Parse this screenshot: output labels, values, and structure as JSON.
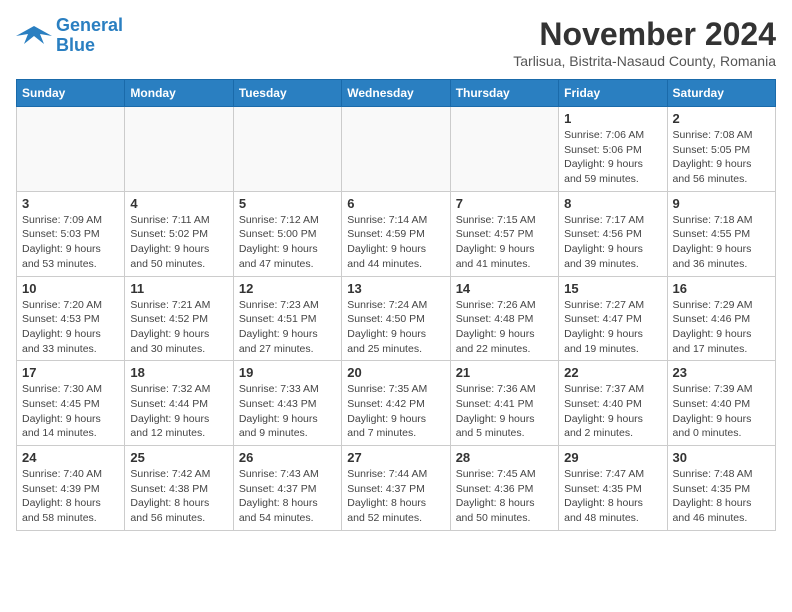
{
  "logo": {
    "line1": "General",
    "line2": "Blue"
  },
  "title": "November 2024",
  "subtitle": "Tarlisua, Bistrita-Nasaud County, Romania",
  "weekdays": [
    "Sunday",
    "Monday",
    "Tuesday",
    "Wednesday",
    "Thursday",
    "Friday",
    "Saturday"
  ],
  "weeks": [
    [
      {
        "day": "",
        "info": ""
      },
      {
        "day": "",
        "info": ""
      },
      {
        "day": "",
        "info": ""
      },
      {
        "day": "",
        "info": ""
      },
      {
        "day": "",
        "info": ""
      },
      {
        "day": "1",
        "info": "Sunrise: 7:06 AM\nSunset: 5:06 PM\nDaylight: 9 hours and 59 minutes."
      },
      {
        "day": "2",
        "info": "Sunrise: 7:08 AM\nSunset: 5:05 PM\nDaylight: 9 hours and 56 minutes."
      }
    ],
    [
      {
        "day": "3",
        "info": "Sunrise: 7:09 AM\nSunset: 5:03 PM\nDaylight: 9 hours and 53 minutes."
      },
      {
        "day": "4",
        "info": "Sunrise: 7:11 AM\nSunset: 5:02 PM\nDaylight: 9 hours and 50 minutes."
      },
      {
        "day": "5",
        "info": "Sunrise: 7:12 AM\nSunset: 5:00 PM\nDaylight: 9 hours and 47 minutes."
      },
      {
        "day": "6",
        "info": "Sunrise: 7:14 AM\nSunset: 4:59 PM\nDaylight: 9 hours and 44 minutes."
      },
      {
        "day": "7",
        "info": "Sunrise: 7:15 AM\nSunset: 4:57 PM\nDaylight: 9 hours and 41 minutes."
      },
      {
        "day": "8",
        "info": "Sunrise: 7:17 AM\nSunset: 4:56 PM\nDaylight: 9 hours and 39 minutes."
      },
      {
        "day": "9",
        "info": "Sunrise: 7:18 AM\nSunset: 4:55 PM\nDaylight: 9 hours and 36 minutes."
      }
    ],
    [
      {
        "day": "10",
        "info": "Sunrise: 7:20 AM\nSunset: 4:53 PM\nDaylight: 9 hours and 33 minutes."
      },
      {
        "day": "11",
        "info": "Sunrise: 7:21 AM\nSunset: 4:52 PM\nDaylight: 9 hours and 30 minutes."
      },
      {
        "day": "12",
        "info": "Sunrise: 7:23 AM\nSunset: 4:51 PM\nDaylight: 9 hours and 27 minutes."
      },
      {
        "day": "13",
        "info": "Sunrise: 7:24 AM\nSunset: 4:50 PM\nDaylight: 9 hours and 25 minutes."
      },
      {
        "day": "14",
        "info": "Sunrise: 7:26 AM\nSunset: 4:48 PM\nDaylight: 9 hours and 22 minutes."
      },
      {
        "day": "15",
        "info": "Sunrise: 7:27 AM\nSunset: 4:47 PM\nDaylight: 9 hours and 19 minutes."
      },
      {
        "day": "16",
        "info": "Sunrise: 7:29 AM\nSunset: 4:46 PM\nDaylight: 9 hours and 17 minutes."
      }
    ],
    [
      {
        "day": "17",
        "info": "Sunrise: 7:30 AM\nSunset: 4:45 PM\nDaylight: 9 hours and 14 minutes."
      },
      {
        "day": "18",
        "info": "Sunrise: 7:32 AM\nSunset: 4:44 PM\nDaylight: 9 hours and 12 minutes."
      },
      {
        "day": "19",
        "info": "Sunrise: 7:33 AM\nSunset: 4:43 PM\nDaylight: 9 hours and 9 minutes."
      },
      {
        "day": "20",
        "info": "Sunrise: 7:35 AM\nSunset: 4:42 PM\nDaylight: 9 hours and 7 minutes."
      },
      {
        "day": "21",
        "info": "Sunrise: 7:36 AM\nSunset: 4:41 PM\nDaylight: 9 hours and 5 minutes."
      },
      {
        "day": "22",
        "info": "Sunrise: 7:37 AM\nSunset: 4:40 PM\nDaylight: 9 hours and 2 minutes."
      },
      {
        "day": "23",
        "info": "Sunrise: 7:39 AM\nSunset: 4:40 PM\nDaylight: 9 hours and 0 minutes."
      }
    ],
    [
      {
        "day": "24",
        "info": "Sunrise: 7:40 AM\nSunset: 4:39 PM\nDaylight: 8 hours and 58 minutes."
      },
      {
        "day": "25",
        "info": "Sunrise: 7:42 AM\nSunset: 4:38 PM\nDaylight: 8 hours and 56 minutes."
      },
      {
        "day": "26",
        "info": "Sunrise: 7:43 AM\nSunset: 4:37 PM\nDaylight: 8 hours and 54 minutes."
      },
      {
        "day": "27",
        "info": "Sunrise: 7:44 AM\nSunset: 4:37 PM\nDaylight: 8 hours and 52 minutes."
      },
      {
        "day": "28",
        "info": "Sunrise: 7:45 AM\nSunset: 4:36 PM\nDaylight: 8 hours and 50 minutes."
      },
      {
        "day": "29",
        "info": "Sunrise: 7:47 AM\nSunset: 4:35 PM\nDaylight: 8 hours and 48 minutes."
      },
      {
        "day": "30",
        "info": "Sunrise: 7:48 AM\nSunset: 4:35 PM\nDaylight: 8 hours and 46 minutes."
      }
    ]
  ]
}
